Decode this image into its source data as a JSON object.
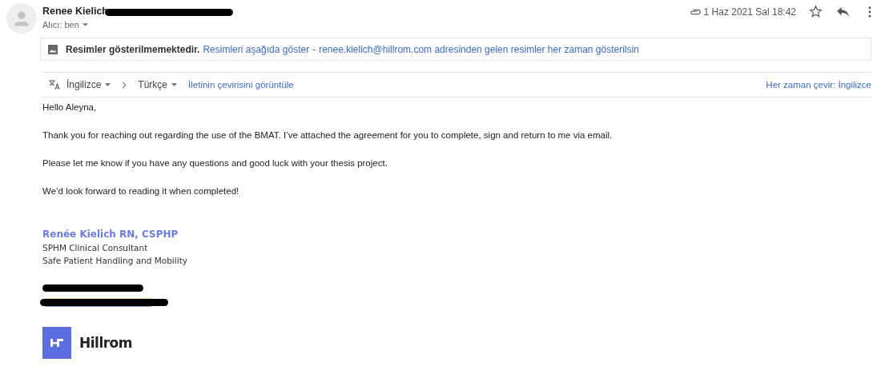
{
  "header": {
    "sender": "Renee Kielich",
    "recipient": "Alıcı: ben",
    "date": "1 Haz 2021 Sal 18:42",
    "has_attachment": true,
    "starred": false
  },
  "images_notice": {
    "title": "Resimler gösterilmemektedir.",
    "show_below": "Resimleri aşağıda göster",
    "separator": "-",
    "always_show": "renee.kielich@hillrom.com adresinden gelen resimler her zaman gösterilsin"
  },
  "translation": {
    "source": "İngilizce",
    "target": "Türkçe",
    "view_link": "İletinin çevirisini görüntüle",
    "always_link": "Her zaman çevir: İngilizce"
  },
  "body": [
    "Hello Aleyna,",
    "Thank you for reaching out regarding the use of the BMAT.  I’ve attached the agreement for you to complete, sign and return to me via email.",
    "Please let me know if you have any questions and good luck with your thesis project.",
    "We’d look forward to reading it when completed!"
  ],
  "signature": {
    "name": "Renée Kielich RN, CSPHP",
    "lines": [
      "SPHM Clinical Consultant",
      "Safe Patient Handling and Mobility"
    ],
    "logo_text": "Hillrom"
  }
}
